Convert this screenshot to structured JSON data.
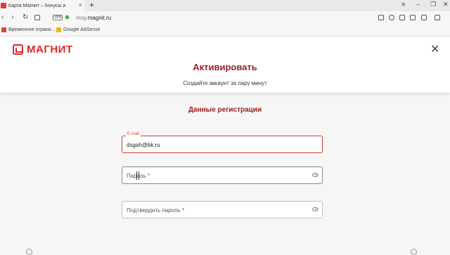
{
  "browser": {
    "tab_title": "Карта Магнит – бонусы и",
    "tab_close": "×",
    "new_tab": "+",
    "vpn": "VPN",
    "url_prefix": "moy.",
    "url_host": "magnit.ru",
    "nav": {
      "back": "‹",
      "forward": "›",
      "reload": "↻"
    },
    "window_controls": [
      "≡",
      "–",
      "❐",
      "✕"
    ]
  },
  "bookmarks": [
    {
      "label": "Временное ограни...",
      "icon": "gmail-icon",
      "color": "#d44638"
    },
    {
      "label": "Google AdSense",
      "icon": "adsense-icon",
      "color": "#f4b400"
    }
  ],
  "header": {
    "logo_text": "МАГНИТ",
    "title": "Активировать",
    "subtitle": "Создайте аккаунт за пару минут",
    "close": "✕"
  },
  "form": {
    "section_title": "Данные регистрации",
    "email": {
      "label": "E-mail",
      "value": "dsgah@bk.ru"
    },
    "password": {
      "placeholder": "Пароль *"
    },
    "confirm": {
      "placeholder": "Подтвердить пароль *"
    }
  },
  "colors": {
    "brand": "#e0262c",
    "accent_text": "#9c1c1c",
    "active_border": "#d43a2f"
  }
}
